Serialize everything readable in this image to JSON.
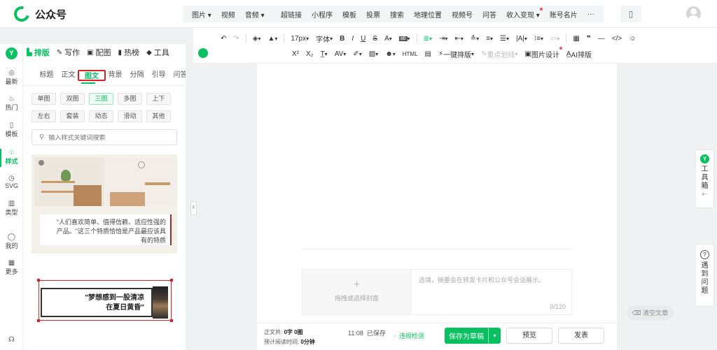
{
  "app": {
    "title": "公众号"
  },
  "top_menu": {
    "media": [
      "图片",
      "视频",
      "音频"
    ],
    "insert": [
      "超链接",
      "小程序",
      "模板",
      "投票",
      "搜索",
      "地理位置",
      "视频号",
      "问答",
      "收入变现",
      "账号名片"
    ],
    "more": "···"
  },
  "toolbar": {
    "row1": {
      "font_size": "17px",
      "font_family": "字体"
    },
    "row2": {
      "one_click": "一键排版",
      "highlight": "重点划线",
      "image_design": "图片设计",
      "ai_layout": "AI排版"
    }
  },
  "rail": {
    "brand": "Y",
    "items": [
      {
        "icon": "newest-icon",
        "glyph": "◎",
        "label": "最新"
      },
      {
        "icon": "hot-icon",
        "glyph": "♨",
        "label": "热门"
      },
      {
        "icon": "template-icon",
        "glyph": "▯",
        "label": "模板"
      },
      {
        "icon": "style-icon",
        "glyph": "♧",
        "label": "样式"
      },
      {
        "icon": "svg-icon",
        "glyph": "◷",
        "label": "SVG"
      },
      {
        "icon": "category-icon",
        "glyph": "▥",
        "label": "类型"
      },
      {
        "icon": "mine-icon",
        "glyph": "◯",
        "label": "我的"
      },
      {
        "icon": "more-icon",
        "glyph": "▦",
        "label": "更多"
      }
    ]
  },
  "panel": {
    "main_tabs": [
      {
        "icon": "layout-icon",
        "glyph": "▙",
        "label": "排版",
        "active": true
      },
      {
        "icon": "write-icon",
        "glyph": "✎",
        "label": "写作",
        "active": false
      },
      {
        "icon": "image-icon",
        "glyph": "▣",
        "label": "配图",
        "active": false
      },
      {
        "icon": "trending-icon",
        "glyph": "▮",
        "label": "热榜",
        "active": false
      },
      {
        "icon": "tools-icon",
        "glyph": "◆",
        "label": "工具",
        "active": false
      }
    ],
    "sub_tabs": [
      "标题",
      "正文",
      "图文",
      "背景",
      "分隔",
      "引导",
      "问答"
    ],
    "active_sub_tab": "图文",
    "chips": [
      "单图",
      "双图",
      "三图",
      "多图",
      "上下",
      "左右",
      "套装",
      "动态",
      "滑动",
      "其他"
    ],
    "active_chip": "三图",
    "search_placeholder": "输入样式关键词搜索",
    "card1_quote": "\"人们喜欢简单、值得信赖、适应性强的产品。\"这三个特质恰恰是产品最应该具有的特质",
    "card2_line1": "\"梦想感到一股清凉",
    "card2_line2": "在夏日黄昏\""
  },
  "editor": {
    "cover_label": "拖拽或选择封面",
    "summary_placeholder": "选填，摘要会在转发卡片和公众号会话展示。",
    "summary_count": "0/120"
  },
  "status": {
    "word_label": "正文共:",
    "word_count": "0字",
    "image_count": "0图",
    "read_label": "预计阅读时间:",
    "read_time": "0分钟",
    "saved_time": "11:08",
    "saved_text": "已保存",
    "check": "违规检测",
    "save_draft": "保存为草稿",
    "preview": "预览",
    "publish": "发表"
  },
  "side": {
    "toolbox": [
      "工",
      "具",
      "箱"
    ],
    "help": [
      "遇",
      "到",
      "问",
      "题"
    ],
    "clear": "清空文章"
  },
  "colors": {
    "accent": "#07c160",
    "highlight_border": "#e02020",
    "badge": "#fa5151"
  }
}
